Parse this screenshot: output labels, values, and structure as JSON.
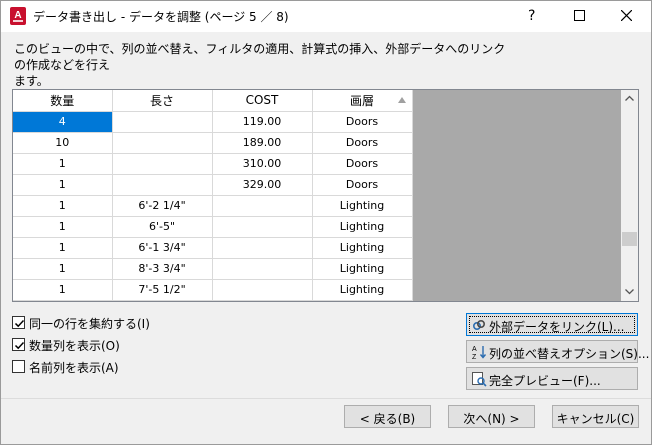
{
  "window": {
    "title": "データ書き出し - データを調整 (ページ 5 ／ 8)"
  },
  "description": {
    "line1": "このビューの中で、列の並べ替え、フィルタの適用、計算式の挿入、外部データへのリンクの作成などを行え",
    "line2": "ます。"
  },
  "grid": {
    "columns": [
      "数量",
      "長さ",
      "COST",
      "画層"
    ],
    "sorted_column": "画層",
    "rows": [
      [
        "4",
        "",
        "119.00",
        "Doors"
      ],
      [
        "10",
        "",
        "189.00",
        "Doors"
      ],
      [
        "1",
        "",
        "310.00",
        "Doors"
      ],
      [
        "1",
        "",
        "329.00",
        "Doors"
      ],
      [
        "1",
        "6'-2 1/4\"",
        "",
        "Lighting"
      ],
      [
        "1",
        "6'-5\"",
        "",
        "Lighting"
      ],
      [
        "1",
        "6'-1 3/4\"",
        "",
        "Lighting"
      ],
      [
        "1",
        "8'-3 3/4\"",
        "",
        "Lighting"
      ],
      [
        "1",
        "7'-5 1/2\"",
        "",
        "Lighting"
      ]
    ],
    "selected_row": 0
  },
  "options": {
    "combine_identical": {
      "label": "同一の行を集約する(I)",
      "checked": true
    },
    "show_count": {
      "label": "数量列を表示(O)",
      "checked": true
    },
    "show_name": {
      "label": "名前列を表示(A)",
      "checked": false
    }
  },
  "actions": {
    "link_external": "外部データをリンク(L)...",
    "sort_options": "列の並べ替えオプション(S)...",
    "full_preview": "完全プレビュー(F)..."
  },
  "footer": {
    "back": "< 戻る(B)",
    "next": "次へ(N) >",
    "cancel": "キャンセル(C)"
  },
  "colors": {
    "selection": "#0078d7",
    "grid_background": "#a9a9a9",
    "app_icon": "#c8102e"
  }
}
